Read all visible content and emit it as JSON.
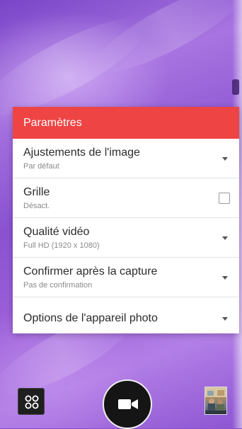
{
  "settings": {
    "title": "Paramètres",
    "items": [
      {
        "title": "Ajustements de l'image",
        "value": "Par défaut",
        "control": "dropdown"
      },
      {
        "title": "Grille",
        "value": "Désact.",
        "control": "checkbox",
        "checked": false
      },
      {
        "title": "Qualité vidéo",
        "value": "Full HD (1920 x 1080)",
        "control": "dropdown"
      },
      {
        "title": "Confirmer après la capture",
        "value": "Pas de confirmation",
        "control": "dropdown"
      },
      {
        "title": "Options de l'appareil photo",
        "control": "dropdown"
      }
    ]
  },
  "controls": {
    "mode_icon": "modes-grid-icon",
    "record_icon": "video-camera-icon",
    "gallery_icon": "gallery-thumbnail"
  },
  "colors": {
    "header": "#ee4443",
    "record_button": "#151515",
    "background": "#8a4fd0"
  }
}
